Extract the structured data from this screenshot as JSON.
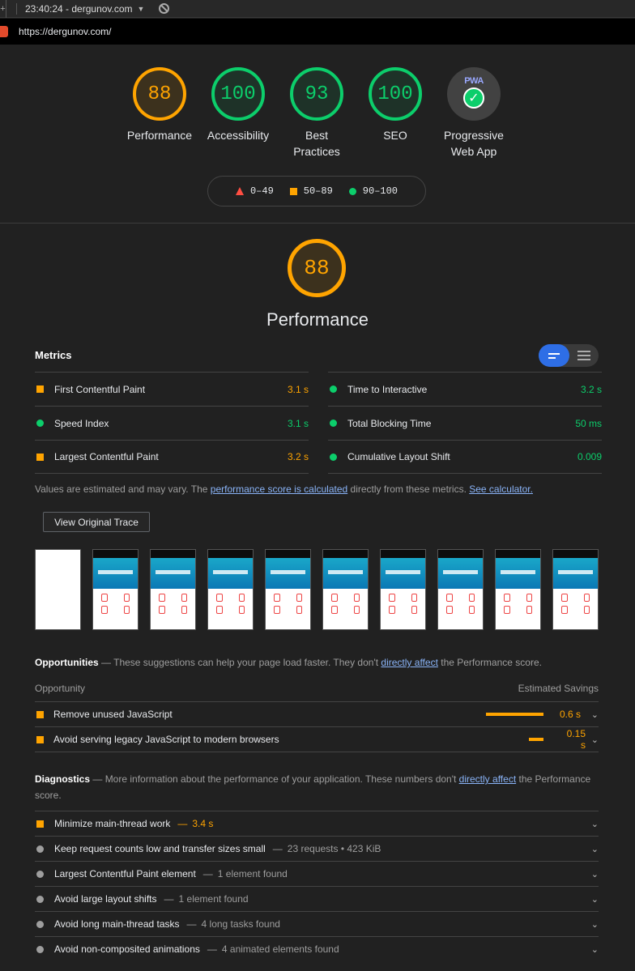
{
  "topbar": {
    "timestamp": "23:40:24 - dergunov.com",
    "edge_glyph": "+"
  },
  "url": "https://dergunov.com/",
  "gauges": [
    {
      "score": "88",
      "label": "Performance",
      "color": "orange"
    },
    {
      "score": "100",
      "label": "Accessibility",
      "color": "green"
    },
    {
      "score": "93",
      "label": "Best Practices",
      "color": "green"
    },
    {
      "score": "100",
      "label": "SEO",
      "color": "green"
    },
    {
      "score": "",
      "label": "Progressive Web App",
      "badge": "PWA",
      "icon": "check-icon"
    }
  ],
  "legend": {
    "fail": "0–49",
    "average": "50–89",
    "pass": "90–100"
  },
  "performance": {
    "score": "88",
    "title": "Performance"
  },
  "metrics": {
    "title": "Metrics",
    "left": [
      {
        "name": "First Contentful Paint",
        "value": "3.1 s",
        "status": "orange"
      },
      {
        "name": "Speed Index",
        "value": "3.1 s",
        "status": "green"
      },
      {
        "name": "Largest Contentful Paint",
        "value": "3.2 s",
        "status": "orange"
      }
    ],
    "right": [
      {
        "name": "Time to Interactive",
        "value": "3.2 s",
        "status": "green"
      },
      {
        "name": "Total Blocking Time",
        "value": "50 ms",
        "status": "green"
      },
      {
        "name": "Cumulative Layout Shift",
        "value": "0.009",
        "status": "green"
      }
    ]
  },
  "note": {
    "text1": "Values are estimated and may vary. The ",
    "link1": "performance score is calculated",
    "text2": " directly from these metrics. ",
    "link2": "See calculator."
  },
  "trace_button": "View Original Trace",
  "opportunities": {
    "title": "Opportunities",
    "dash": " — ",
    "desc1": "These suggestions can help your page load faster. They don't ",
    "link": "directly affect",
    "desc2": " the Performance score.",
    "col_opportunity": "Opportunity",
    "col_savings": "Estimated Savings",
    "items": [
      {
        "name": "Remove unused JavaScript",
        "savings": "0.6 s",
        "fraction": 1.0
      },
      {
        "name": "Avoid serving legacy JavaScript to modern browsers",
        "savings": "0.15 s",
        "fraction": 0.25
      }
    ]
  },
  "diagnostics": {
    "title": "Diagnostics",
    "dash": " — ",
    "desc1": "More information about the performance of your application. These numbers don't ",
    "link": "directly affect",
    "desc2": " the Performance score.",
    "items": [
      {
        "name": "Minimize main-thread work",
        "detail": "3.4 s",
        "status": "orange"
      },
      {
        "name": "Keep request counts low and transfer sizes small",
        "detail": "23 requests • 423 KiB",
        "status": "gray"
      },
      {
        "name": "Largest Contentful Paint element",
        "detail": "1 element found",
        "status": "gray"
      },
      {
        "name": "Avoid large layout shifts",
        "detail": "1 element found",
        "status": "gray"
      },
      {
        "name": "Avoid long main-thread tasks",
        "detail": "4 long tasks found",
        "status": "gray"
      },
      {
        "name": "Avoid non-composited animations",
        "detail": "4 animated elements found",
        "status": "gray"
      }
    ]
  },
  "colors": {
    "orange": "#ffa400",
    "green": "#0cce6b",
    "red": "#ff4e42",
    "link": "#8ab4f8"
  }
}
